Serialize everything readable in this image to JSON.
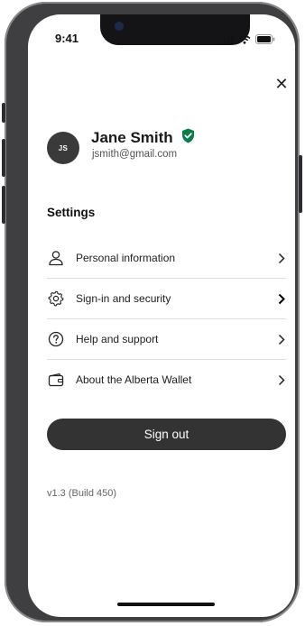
{
  "status_bar": {
    "time": "9:41"
  },
  "profile": {
    "initials": "JS",
    "name": "Jane Smith",
    "email": "jsmith@gmail.com",
    "verified_color": "#0a7d4b"
  },
  "settings": {
    "title": "Settings",
    "items": [
      {
        "label": "Personal information",
        "icon": "person-icon"
      },
      {
        "label": "Sign-in and security",
        "icon": "gear-icon"
      },
      {
        "label": "Help and support",
        "icon": "question-circle-icon"
      },
      {
        "label": "About the Alberta Wallet",
        "icon": "wallet-icon"
      }
    ]
  },
  "actions": {
    "sign_out_label": "Sign out"
  },
  "footer": {
    "version": "v1.3 (Build 450)"
  },
  "theme": {
    "button_color": "#333333",
    "divider_color": "#dedede"
  }
}
